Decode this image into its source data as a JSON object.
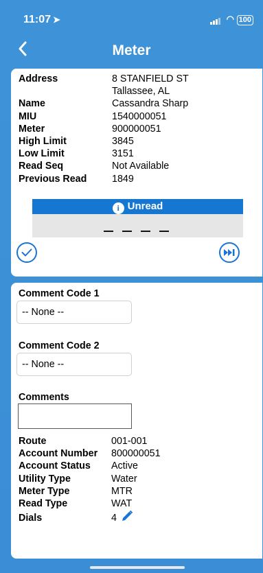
{
  "status_bar": {
    "time": "11:07",
    "battery": "100"
  },
  "nav": {
    "back": "‹",
    "title": "Meter"
  },
  "meter_info": [
    {
      "label": "Address",
      "value": "8 STANFIELD ST"
    },
    {
      "label": "",
      "value": "Tallassee, AL"
    },
    {
      "label": "Name",
      "value": "Cassandra Sharp"
    },
    {
      "label": "MIU",
      "value": "1540000051"
    },
    {
      "label": "Meter",
      "value": "900000051"
    },
    {
      "label": "High Limit",
      "value": "3845"
    },
    {
      "label": "Low Limit",
      "value": "3151"
    },
    {
      "label": "Read Seq",
      "value": "Not Available"
    },
    {
      "label": "Previous Read",
      "value": "1849"
    }
  ],
  "read_status": {
    "icon": "i",
    "label": "Unread"
  },
  "comments": {
    "code1_label": "Comment Code 1",
    "code1_value": "-- None --",
    "code2_label": "Comment Code 2",
    "code2_value": "-- None --",
    "comments_label": "Comments",
    "comments_value": ""
  },
  "account_info": [
    {
      "label": "Route",
      "value": "001-001"
    },
    {
      "label": "Account Number",
      "value": "800000051"
    },
    {
      "label": "Account Status",
      "value": "Active"
    },
    {
      "label": "Utility Type",
      "value": "Water"
    },
    {
      "label": "Meter Type",
      "value": "MTR"
    },
    {
      "label": "Read Type",
      "value": "WAT"
    },
    {
      "label": "Dials",
      "value": "4"
    }
  ],
  "colors": {
    "background": "#3b8ed5",
    "accent": "#1577d2"
  }
}
